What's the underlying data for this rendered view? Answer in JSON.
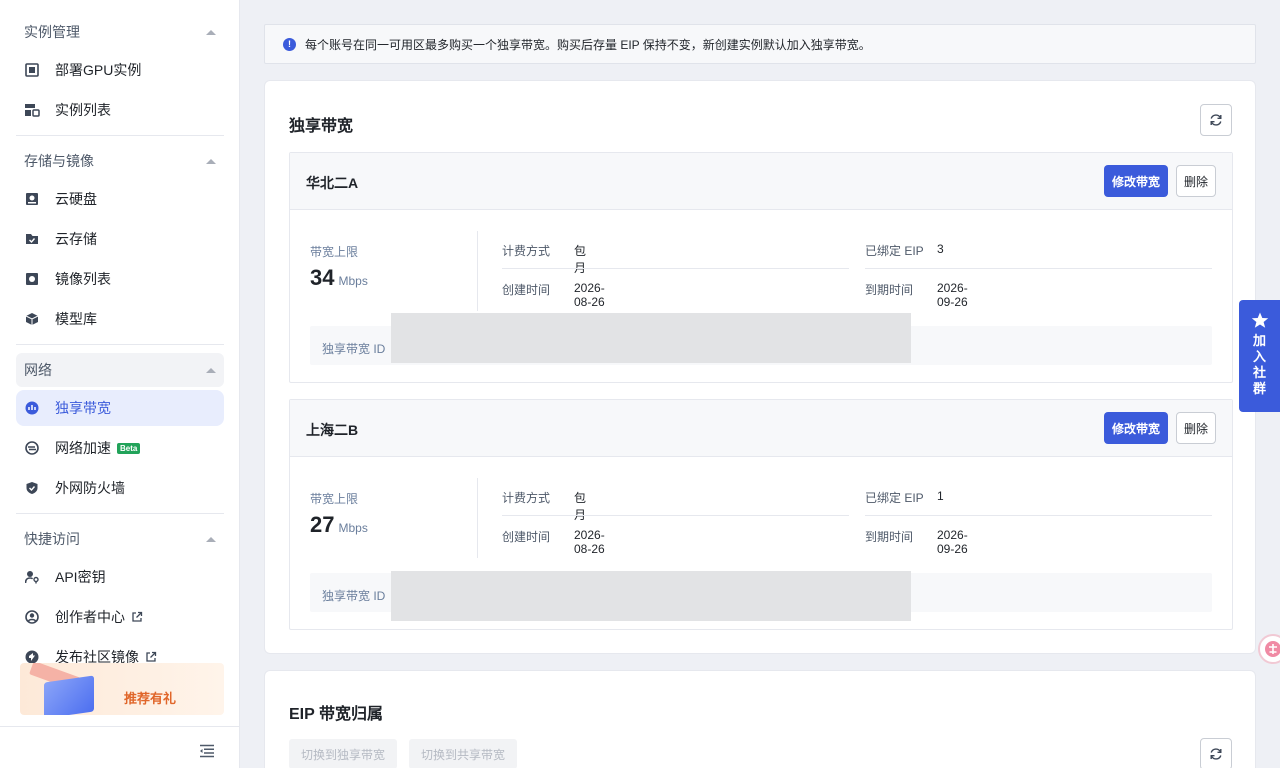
{
  "sidebar": {
    "groups": [
      {
        "title": "实例管理",
        "items": [
          {
            "label": "部署GPU实例"
          },
          {
            "label": "实例列表"
          }
        ]
      },
      {
        "title": "存储与镜像",
        "items": [
          {
            "label": "云硬盘"
          },
          {
            "label": "云存储"
          },
          {
            "label": "镜像列表"
          },
          {
            "label": "模型库"
          }
        ]
      },
      {
        "title": "网络",
        "items": [
          {
            "label": "独享带宽"
          },
          {
            "label": "网络加速",
            "badge": "Beta"
          },
          {
            "label": "外网防火墙"
          }
        ]
      },
      {
        "title": "快捷访问",
        "items": [
          {
            "label": "API密钥"
          },
          {
            "label": "创作者中心"
          },
          {
            "label": "发布社区镜像"
          }
        ]
      }
    ],
    "promo": "推荐有礼"
  },
  "notice": "每个账号在同一可用区最多购买一个独享带宽。购买后存量 EIP 保持不变，新创建实例默认加入独享带宽。",
  "bandwidth_card": {
    "title": "独享带宽",
    "regions": [
      {
        "name": "华北二A",
        "modify_label": "修改带宽",
        "delete_label": "删除",
        "bw_label": "带宽上限",
        "bw_value": "34",
        "bw_unit": "Mbps",
        "billing_key": "计费方式",
        "billing_value": "包月",
        "eip_key": "已绑定 EIP",
        "eip_value": "3",
        "created_key": "创建时间",
        "created_value": "2026-08-26",
        "expire_key": "到期时间",
        "expire_value": "2026-09-26",
        "id_label": "独享带宽 ID"
      },
      {
        "name": "上海二B",
        "modify_label": "修改带宽",
        "delete_label": "删除",
        "bw_label": "带宽上限",
        "bw_value": "27",
        "bw_unit": "Mbps",
        "billing_key": "计费方式",
        "billing_value": "包月",
        "eip_key": "已绑定 EIP",
        "eip_value": "1",
        "created_key": "创建时间",
        "created_value": "2026-08-26",
        "expire_key": "到期时间",
        "expire_value": "2026-09-26",
        "id_label": "独享带宽 ID"
      }
    ]
  },
  "eip_card": {
    "title": "EIP 带宽归属",
    "switch_exclusive": "切换到独享带宽",
    "switch_shared": "切换到共享带宽"
  },
  "community": "加入社群",
  "colors": {
    "accent": "#3b5bdb",
    "beta": "#22a35a",
    "active_bg": "#e8edfd"
  }
}
